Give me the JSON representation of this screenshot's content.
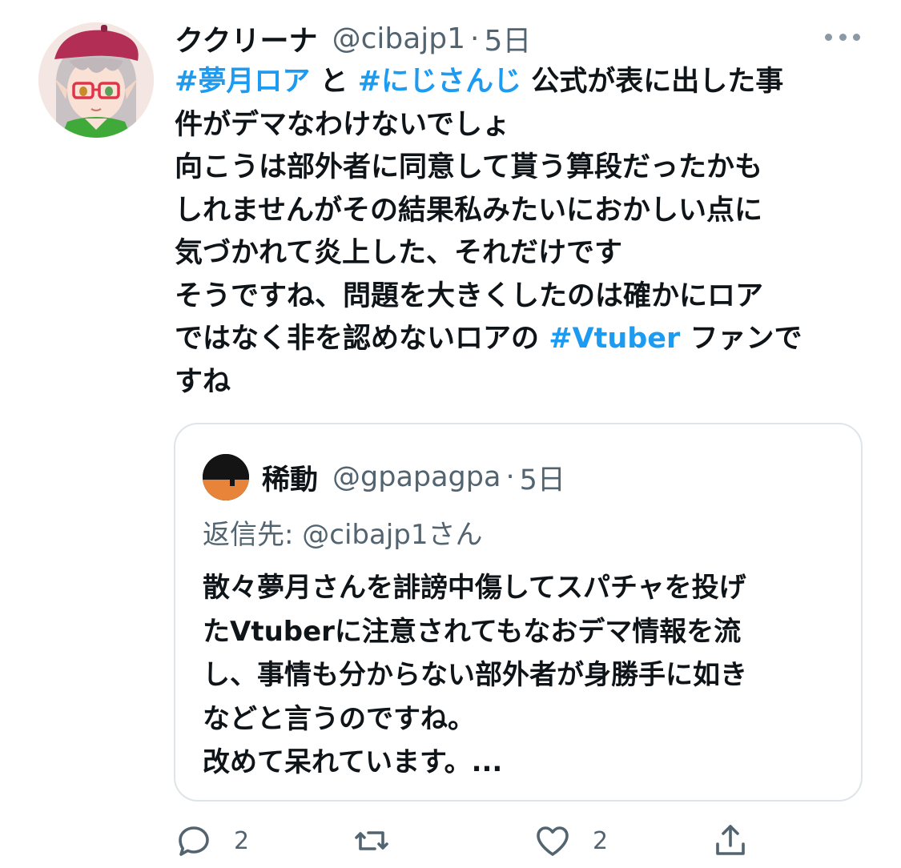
{
  "tweet": {
    "author_name": "ククリーナ",
    "handle": "@cibajp1",
    "separator": "·",
    "time": "5日",
    "text_lines": [
      [
        {
          "t": "#夢月ロア",
          "tag": true
        },
        {
          "t": " と ",
          "tag": false
        },
        {
          "t": "#にじさんじ",
          "tag": true
        },
        {
          "t": " 公式が表に出した事",
          "tag": false
        }
      ],
      [
        {
          "t": "件がデマなわけないでしょ",
          "tag": false
        }
      ],
      [
        {
          "t": "向こうは部外者に同意して貰う算段だったかも",
          "tag": false
        }
      ],
      [
        {
          "t": "しれませんがその結果私みたいにおかしい点に",
          "tag": false
        }
      ],
      [
        {
          "t": "気づかれて炎上した、それだけです",
          "tag": false
        }
      ],
      [
        {
          "t": "そうですね、問題を大きくしたのは確かにロア",
          "tag": false
        }
      ],
      [
        {
          "t": "ではなく非を認めないロアの ",
          "tag": false
        },
        {
          "t": "#Vtuber",
          "tag": true
        },
        {
          "t": " ファンで",
          "tag": false
        }
      ],
      [
        {
          "t": "すね",
          "tag": false
        }
      ]
    ]
  },
  "quote": {
    "author_name": "稀動",
    "handle": "@gpapagpa",
    "separator": "·",
    "time": "5日",
    "reply_to": "返信先: @cibajp1さん",
    "text_lines": [
      "散々夢月さんを誹謗中傷してスパチャを投げ",
      "たVtuberに注意されてもなおデマ情報を流",
      "し、事情も分からない部外者が身勝手に如き",
      "などと言うのですね。",
      "改めて呆れています。..."
    ]
  },
  "actions": {
    "reply_count": "2",
    "retweet_count": "",
    "like_count": "2",
    "icons": [
      "reply-icon",
      "retweet-icon",
      "like-icon",
      "share-icon"
    ]
  },
  "colors": {
    "hashtag": "#1d9bf0",
    "secondary_text": "#536471",
    "border": "#dfe4e8"
  }
}
